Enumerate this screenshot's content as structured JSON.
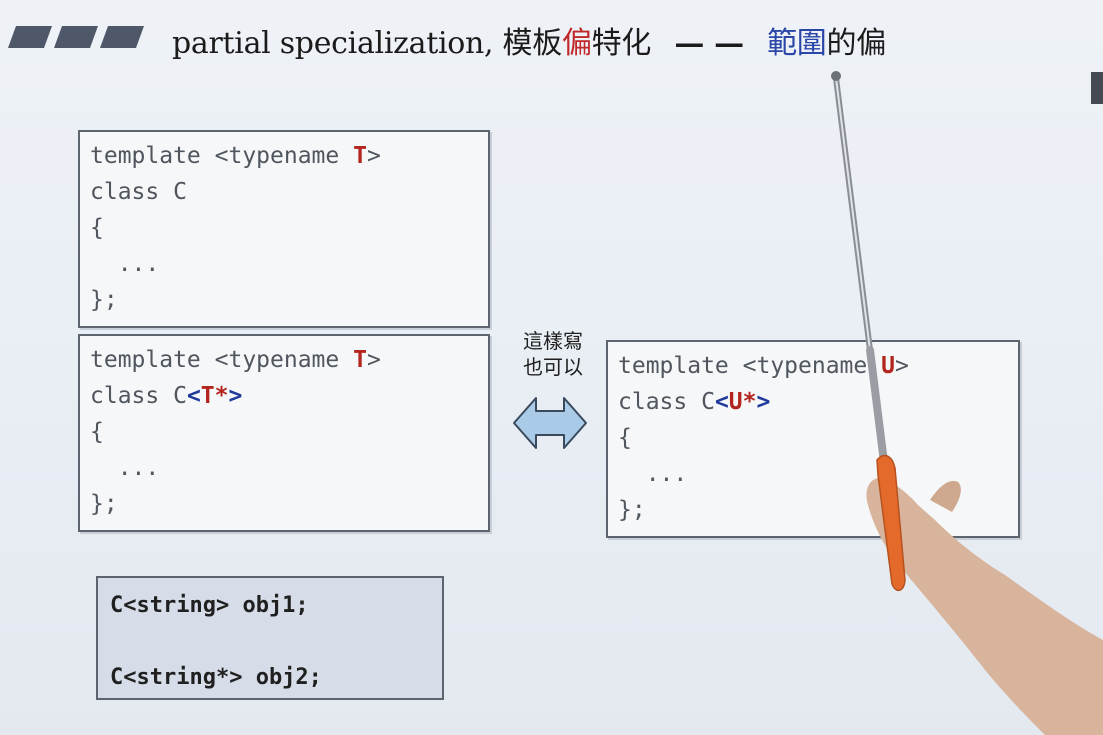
{
  "header": {
    "title_en": "partial specialization,",
    "title_cn_1": "模板",
    "title_cn_red": "偏",
    "title_cn_2": "特化",
    "title_dash": "— —",
    "title_cn_blue": "範圍",
    "title_cn_3": "的偏"
  },
  "box1": {
    "l1_a": "template <typename ",
    "l1_t": "T",
    "l1_b": ">",
    "l2": "class C",
    "l3": "{",
    "l4": "  ...",
    "l5": "};"
  },
  "box2": {
    "l1_a": "template <typename ",
    "l1_t": "T",
    "l1_b": ">",
    "l2_a": "class C",
    "l2_lt": "<",
    "l2_t": "T*",
    "l2_gt": ">",
    "l3": "{",
    "l4": "  ...",
    "l5": "};"
  },
  "middle": {
    "note_line1": "這樣寫",
    "note_line2": "也可以",
    "arrow_icon": "double-arrow-icon",
    "arrow_color": "#a9cbe8"
  },
  "box3": {
    "l1_a": "template <typename ",
    "l1_t": "U",
    "l1_b": ">",
    "l2_a": "class C",
    "l2_lt": "<",
    "l2_t": "U*",
    "l2_gt": ">",
    "l3": "{",
    "l4": "  ...",
    "l5": "};"
  },
  "box4": {
    "l1": "C<string> obj1;",
    "l2": "",
    "l3": "C<string*> obj2;"
  },
  "colors": {
    "accent_red": "#c0282a",
    "accent_blue": "#2a46a8",
    "header_bars": "#4f5868"
  }
}
